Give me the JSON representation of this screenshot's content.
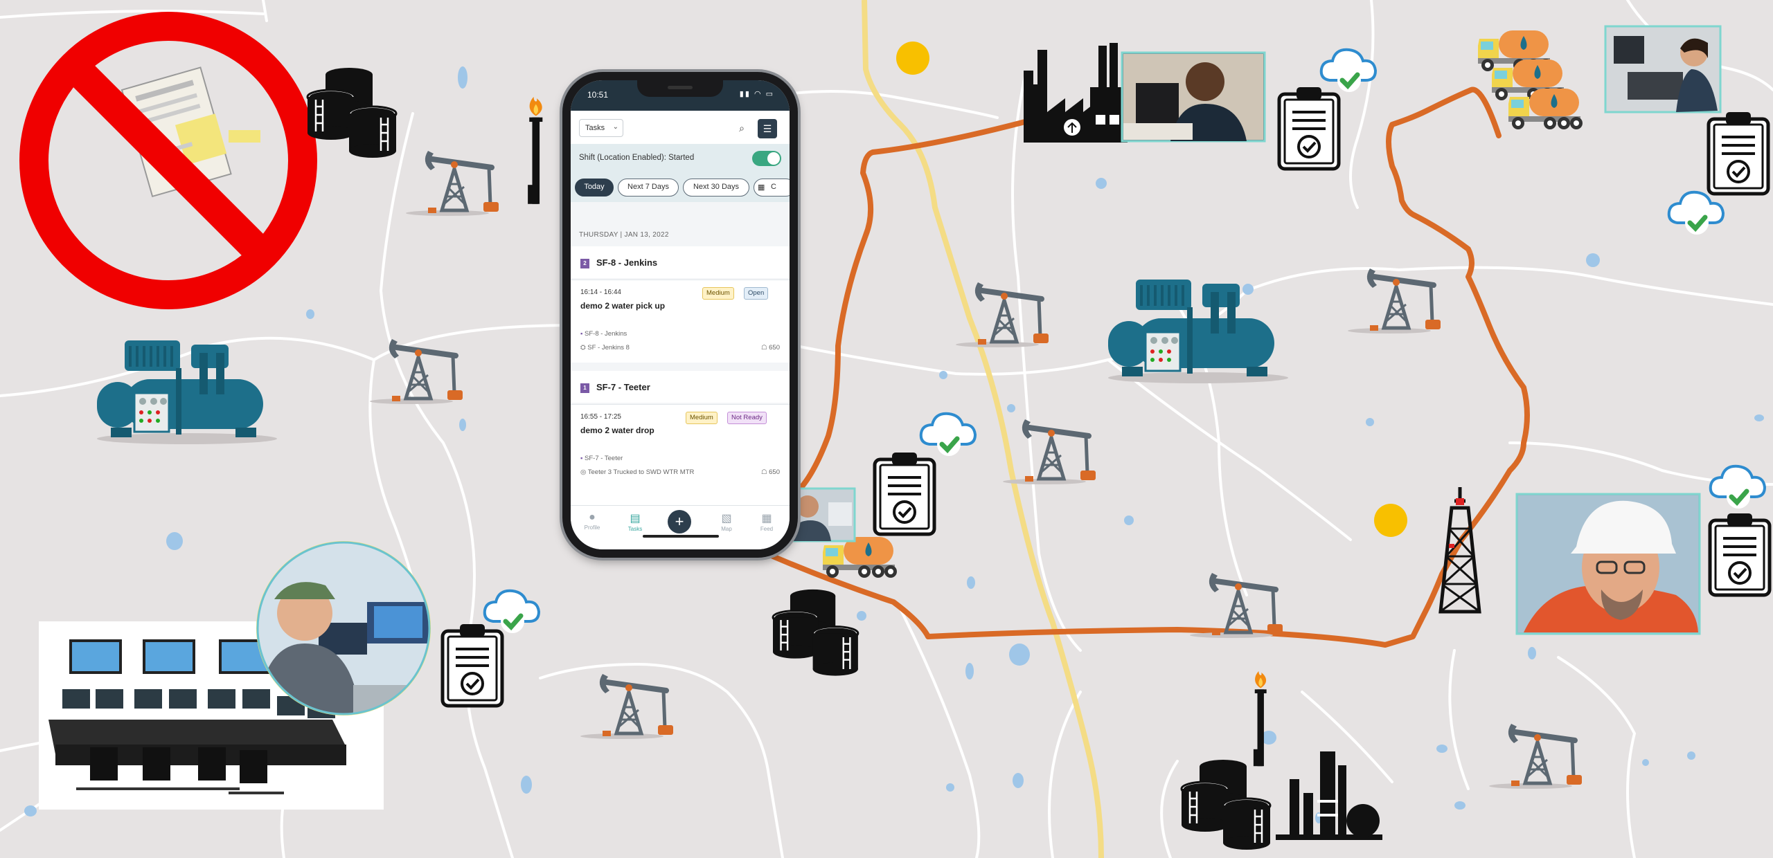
{
  "phone": {
    "status_time": "10:51",
    "tasks_select": "Tasks",
    "shift_status": "Shift (Location Enabled): Started",
    "chips": [
      "Today",
      "Next 7 Days",
      "Next 30 Days",
      "C"
    ],
    "date_header": "THURSDAY | JAN 13, 2022",
    "groups": [
      {
        "badge": "2",
        "title": "SF-8 - Jenkins",
        "card": {
          "time": "16:14 - 16:44",
          "title": "demo 2 water pick up",
          "priority": "Medium",
          "status": "Open",
          "meta1": "SF-8 - Jenkins",
          "meta2": "SF - Jenkins 8",
          "qty": "650"
        }
      },
      {
        "badge": "1",
        "title": "SF-7 - Teeter",
        "card": {
          "time": "16:55 - 17:25",
          "title": "demo 2 water drop",
          "priority": "Medium",
          "status": "Not Ready",
          "meta1": "SF-7 - Teeter",
          "meta2": "Teeter 3 Trucked to SWD WTR MTR",
          "qty": "650"
        }
      }
    ],
    "nav": [
      "Profile",
      "Tasks",
      "",
      "Map",
      "Feed"
    ]
  },
  "colors": {
    "map_bg": "#e6e3e3",
    "route": "#d96a26",
    "highway": "#f4dc85",
    "water": "#9fc6e8",
    "equipment": "#1d6f8a",
    "prohibit": "#f00000",
    "accent": "#3aa781"
  },
  "icons": [
    "prohibited-paper-icon",
    "storage-tanks-icon",
    "flare-stack-icon",
    "pumpjack-icon",
    "compressor-icon",
    "factory-icon",
    "clipboard-check-icon",
    "cloud-check-icon",
    "tanker-truck-icon",
    "drilling-rig-icon",
    "refinery-icon",
    "location-dot-icon"
  ]
}
